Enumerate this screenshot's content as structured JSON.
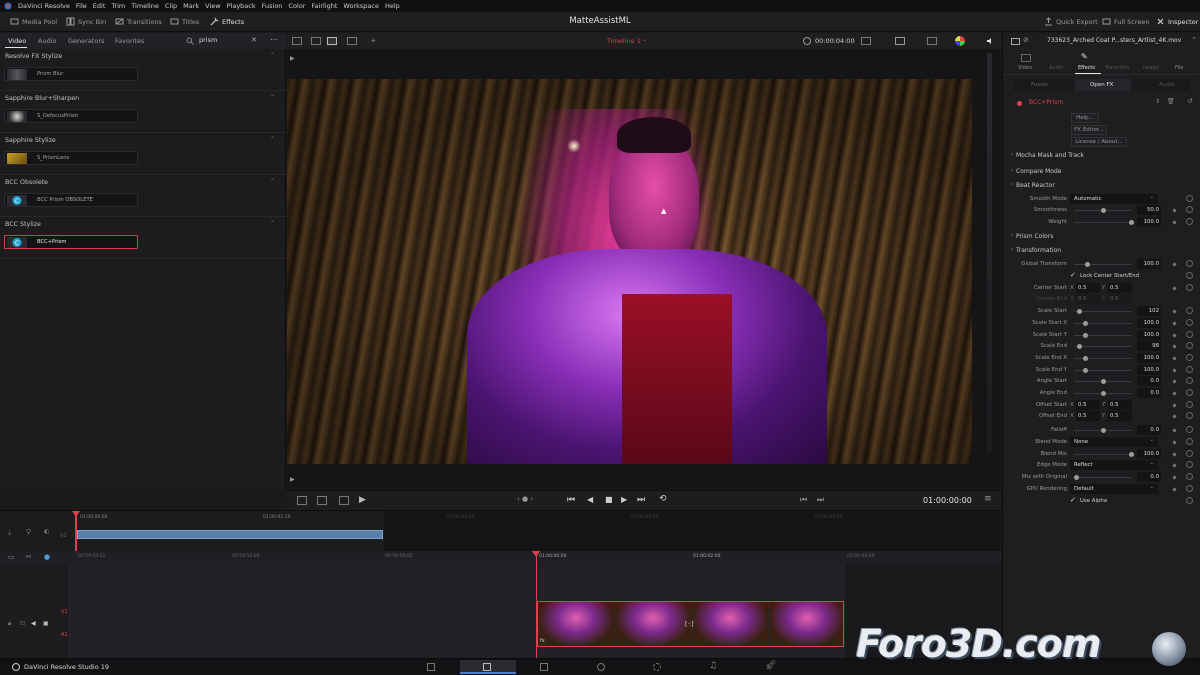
{
  "menubar": {
    "app_name": "DaVinci Resolve",
    "items": [
      "File",
      "Edit",
      "Trim",
      "Timeline",
      "Clip",
      "Mark",
      "View",
      "Playback",
      "Fusion",
      "Color",
      "Fairlight",
      "Workspace",
      "Help"
    ]
  },
  "toolbar": {
    "media_pool": "Media Pool",
    "sync_bin": "Sync Bin",
    "transitions": "Transitions",
    "titles": "Titles",
    "effects": "Effects",
    "project_title": "MatteAssistML",
    "quick_export": "Quick Export",
    "full_screen": "Full Screen",
    "inspector": "Inspector"
  },
  "effects_panel": {
    "tabs": [
      "Video",
      "Audio",
      "Generators",
      "Favorites"
    ],
    "active_tab": "Video",
    "search_value": "prism",
    "categories": [
      {
        "title": "Resolve FX Stylize",
        "item": "Prism Blur"
      },
      {
        "title": "Sapphire Blur+Sharpen",
        "item": "S_DefocusPrism"
      },
      {
        "title": "Sapphire Stylize",
        "item": "S_PrismLens"
      },
      {
        "title": "BCC Obsolete",
        "item": "BCC Prism OBSOLETE"
      },
      {
        "title": "BCC Stylize",
        "item": "BCC+Prism"
      }
    ]
  },
  "viewer": {
    "timeline_name": "Timeline 1",
    "duration": "00:00:04:00",
    "timecode": "01:00:00:00"
  },
  "timeline": {
    "mini_ticks": [
      "01:00:00:00",
      "01:00:02:10",
      "01:00:04:20",
      "01:00:07:06",
      "01:00:09:16"
    ],
    "ruler_ticks": [
      "00:59:54:22",
      "00:59:56:00",
      "00:59:58:02",
      "01:00:00:00",
      "01:00:02:00",
      "01:00:04:00"
    ],
    "track_labels": {
      "video": "V1",
      "audio": "A1"
    }
  },
  "inspector": {
    "clip_name": "733623_Arched Coat P...sters_Artlist_4K.mov",
    "tabs": [
      "Video",
      "Audio",
      "Effects",
      "Transition",
      "Image",
      "File"
    ],
    "active_tab": "Effects",
    "sub_tabs": [
      "Fusion",
      "Open FX",
      "Audio"
    ],
    "active_sub_tab": "Open FX",
    "effect_name": "BCC+Prism",
    "buttons": [
      "Help...",
      "FX Editor...",
      "License / About..."
    ],
    "sections": {
      "mocha": "Mocha Mask and Track",
      "compare": "Compare Mode",
      "beat": "Beat Reactor",
      "prism_colors": "Prism Colors",
      "transformation": "Transformation"
    },
    "smooth_mode": {
      "label": "Smooth Mode",
      "value": "Automatic"
    },
    "smoothness": {
      "label": "Smoothness",
      "value": "50.0",
      "level": 0.5
    },
    "weight": {
      "label": "Weight",
      "value": "100.0",
      "level": 1.0
    },
    "global_transform": {
      "label": "Global Transform",
      "value": "100.0",
      "level": 0.2
    },
    "lock_center": "Lock Center Start/End",
    "center_start": {
      "label": "Center Start",
      "x": "0.5",
      "y": "0.5"
    },
    "center_end": {
      "label": "Center End",
      "x": "0.5",
      "y": "0.5"
    },
    "scale_start": {
      "label": "Scale Start",
      "value": "102",
      "level": 0.1
    },
    "scale_start_x": {
      "label": "Scale Start X",
      "value": "100.0",
      "level": 0.2
    },
    "scale_start_y": {
      "label": "Scale Start Y",
      "value": "100.0",
      "level": 0.2
    },
    "scale_end": {
      "label": "Scale End",
      "value": "98",
      "level": 0.1
    },
    "scale_end_x": {
      "label": "Scale End X",
      "value": "100.0",
      "level": 0.2
    },
    "scale_end_y": {
      "label": "Scale End Y",
      "value": "100.0",
      "level": 0.2
    },
    "angle_start": {
      "label": "Angle Start",
      "value": "0.0",
      "level": 0.5
    },
    "angle_end": {
      "label": "Angle End",
      "value": "0.0",
      "level": 0.5
    },
    "offset_start": {
      "label": "Offset Start",
      "x": "0.5",
      "y": "0.5"
    },
    "offset_end": {
      "label": "Offset End",
      "x": "0.5",
      "y": "0.5"
    },
    "falloff": {
      "label": "Falloff",
      "value": "0.0",
      "level": 0.5
    },
    "blend_mode": {
      "label": "Blend Mode",
      "value": "None"
    },
    "blend_mix": {
      "label": "Blend Mix",
      "value": "100.0",
      "level": 1.0
    },
    "edge_mode": {
      "label": "Edge Mode",
      "value": "Reflect"
    },
    "mix_original": {
      "label": "Mix with Original",
      "value": "0.0",
      "level": 0.0
    },
    "gpu_rendering": {
      "label": "GPU Rendering",
      "value": "Default"
    },
    "use_alpha": "Use Alpha"
  },
  "footer": {
    "app_version": "DaVinci Resolve Studio 19",
    "watermark": "Foro3D.com"
  },
  "colors": {
    "accent_red": "#d43b4a",
    "playhead": "#e0404e",
    "clip_blue": "#5a7fa8"
  }
}
